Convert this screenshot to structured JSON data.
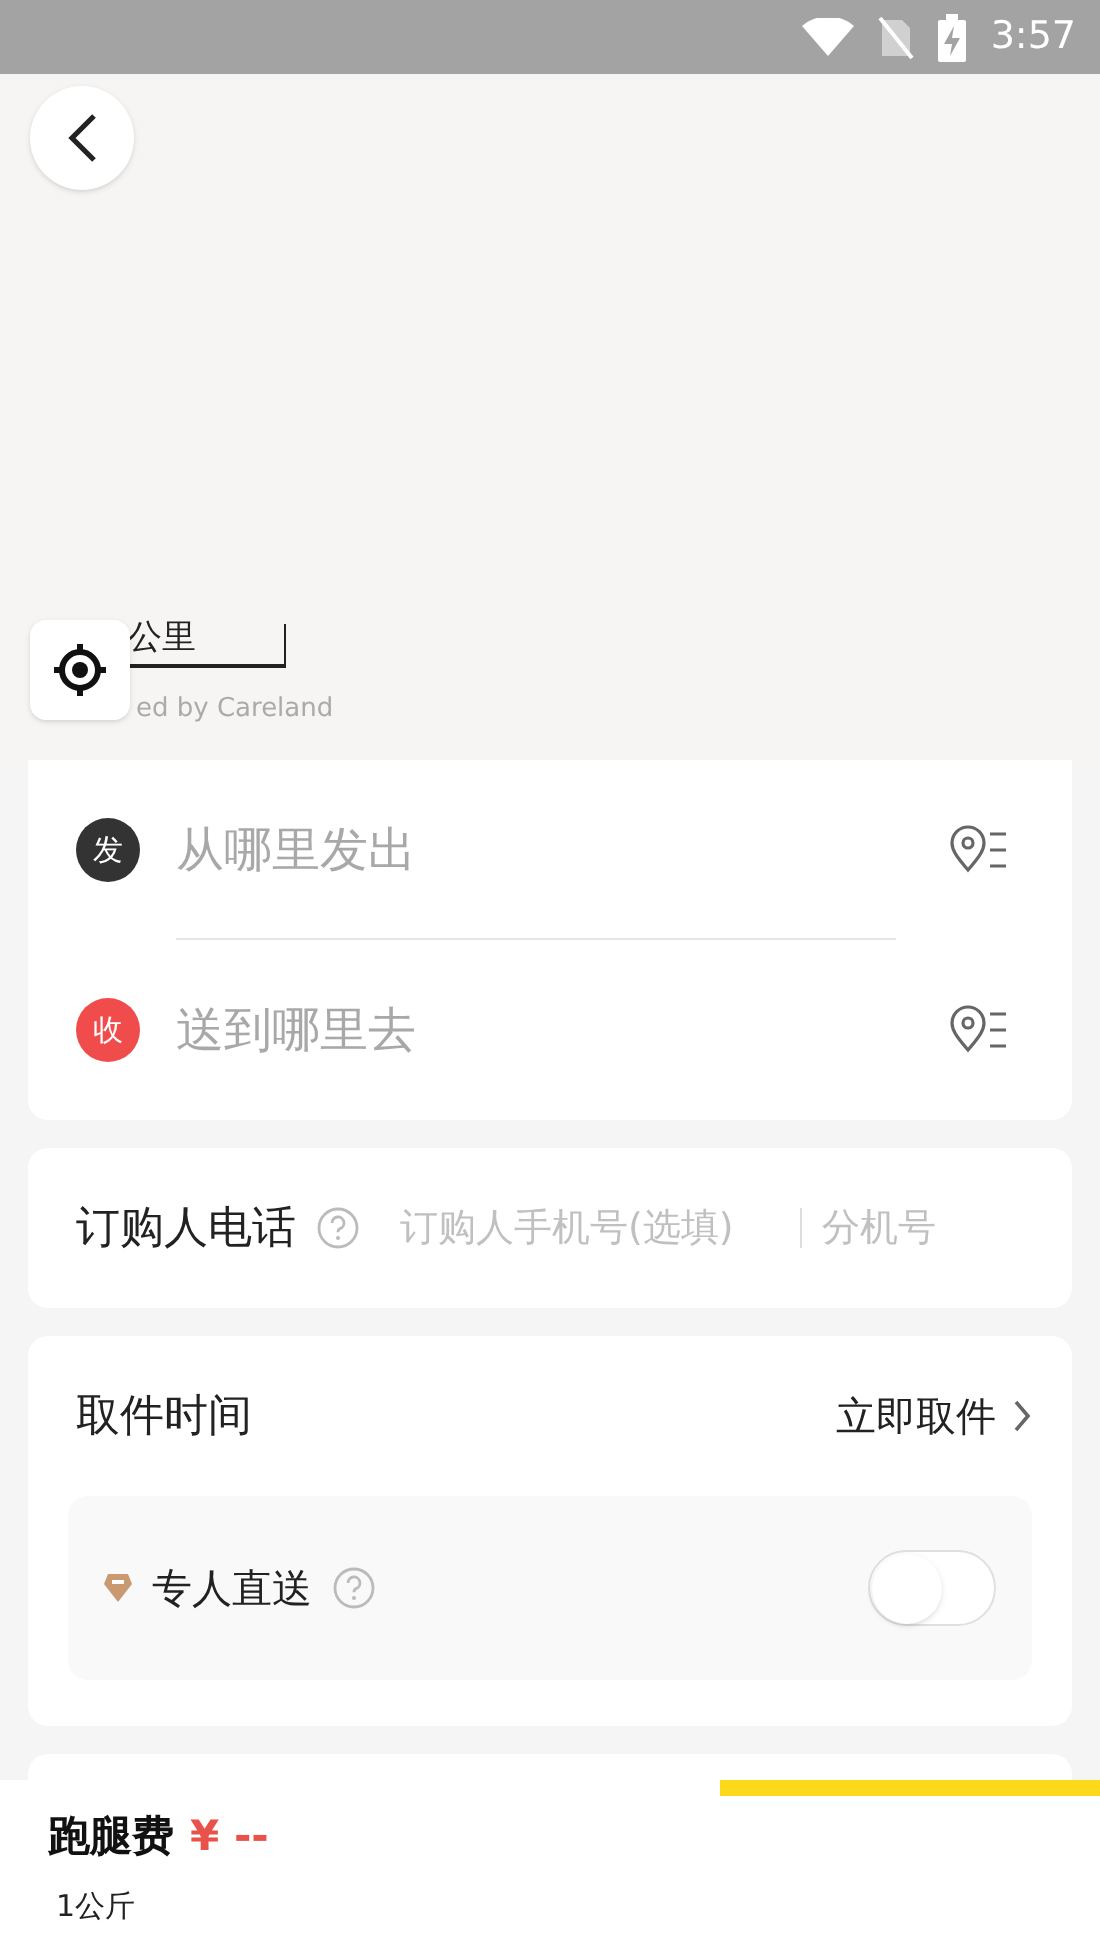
{
  "status_bar": {
    "time": "3:57"
  },
  "map": {
    "scale_label": "公里",
    "credit": "ed by Careland"
  },
  "address": {
    "rows": [
      {
        "kind": "send",
        "badge": "发",
        "placeholder": "从哪里发出"
      },
      {
        "kind": "receive",
        "badge": "收",
        "placeholder": "送到哪里去"
      }
    ]
  },
  "phone": {
    "label": "订购人电话",
    "placeholder": "订购人手机号(选填)",
    "extension_placeholder": "分机号"
  },
  "pickup": {
    "label": "取件时间",
    "value": "立即取件",
    "option": {
      "label": "专人直送",
      "on": false
    }
  },
  "footer": {
    "fee_label": "跑腿费",
    "currency": "¥",
    "amount": "--",
    "weight": "1公斤"
  }
}
